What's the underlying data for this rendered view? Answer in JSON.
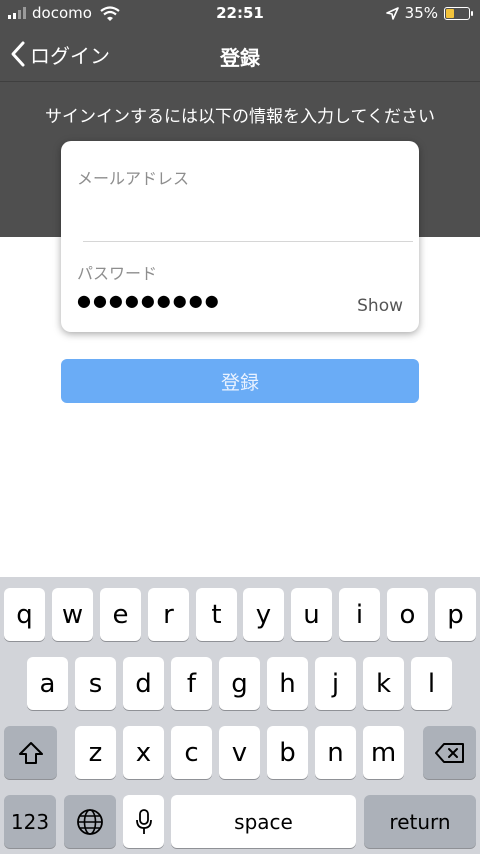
{
  "status_bar": {
    "carrier": "docomo",
    "time": "22:51",
    "battery_percent": "35%",
    "battery_level": 0.35,
    "icons": [
      "signal-icon",
      "wifi-icon",
      "location-arrow-icon",
      "battery-icon"
    ]
  },
  "nav": {
    "back_label": "ログイン",
    "title": "登録",
    "back_icon": "chevron-left-icon"
  },
  "header": {
    "instruction": "サインインするには以下の情報を入力してください"
  },
  "form": {
    "email_label": "メールアドレス",
    "email_value": "",
    "password_label": "パスワード",
    "password_masked": "●●●●●●●●●",
    "show_label": "Show"
  },
  "register_button": {
    "label": "登録"
  },
  "colors": {
    "header_bg": "#4f4f4f",
    "button_bg": "#6aacf6",
    "keyboard_bg": "#d2d4d9",
    "battery_fill": "#f3c33b"
  },
  "keyboard": {
    "row1": [
      "q",
      "w",
      "e",
      "r",
      "t",
      "y",
      "u",
      "i",
      "o",
      "p"
    ],
    "row2": [
      "a",
      "s",
      "d",
      "f",
      "g",
      "h",
      "j",
      "k",
      "l"
    ],
    "row3": [
      "z",
      "x",
      "c",
      "v",
      "b",
      "n",
      "m"
    ],
    "num_label": "123",
    "space_label": "space",
    "return_label": "return",
    "icons": [
      "shift-icon",
      "delete-icon",
      "globe-icon",
      "microphone-icon"
    ]
  }
}
